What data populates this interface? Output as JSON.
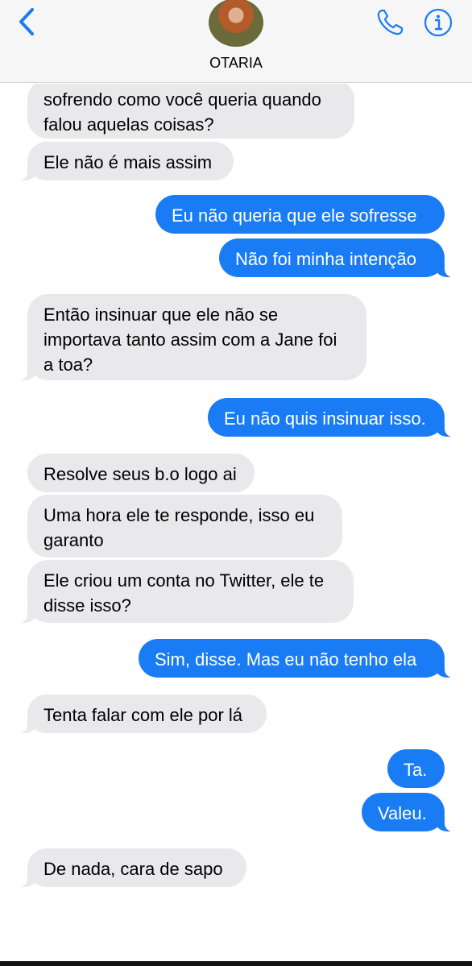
{
  "header": {
    "contact_name": "OTARIA",
    "back_icon": "chevron-left-icon",
    "call_icon": "phone-icon",
    "info_icon": "info-icon",
    "accent_color": "#1a7cf5"
  },
  "messages": [
    {
      "direction": "received",
      "text": "sofrendo como você queria quando\nfalou aquelas coisas?"
    },
    {
      "direction": "received",
      "text": "Ele não é mais assim"
    },
    {
      "direction": "sent",
      "text": "Eu não queria que ele sofresse"
    },
    {
      "direction": "sent",
      "text": "Não foi minha intenção"
    },
    {
      "direction": "received",
      "text": "Então insinuar que ele não se\nimportava tanto assim com a Jane foi\na toa?"
    },
    {
      "direction": "sent",
      "text": "Eu não quis insinuar isso."
    },
    {
      "direction": "received",
      "text": "Resolve seus b.o logo ai"
    },
    {
      "direction": "received",
      "text": "Uma hora ele te responde, isso eu\ngaranto"
    },
    {
      "direction": "received",
      "text": "Ele criou um conta no Twitter, ele te\ndisse isso?"
    },
    {
      "direction": "sent",
      "text": "Sim, disse. Mas eu não tenho ela"
    },
    {
      "direction": "received",
      "text": "Tenta falar com ele por lá"
    },
    {
      "direction": "sent",
      "text": "Ta."
    },
    {
      "direction": "sent",
      "text": "Valeu."
    },
    {
      "direction": "received",
      "text": "De nada, cara de sapo"
    }
  ]
}
